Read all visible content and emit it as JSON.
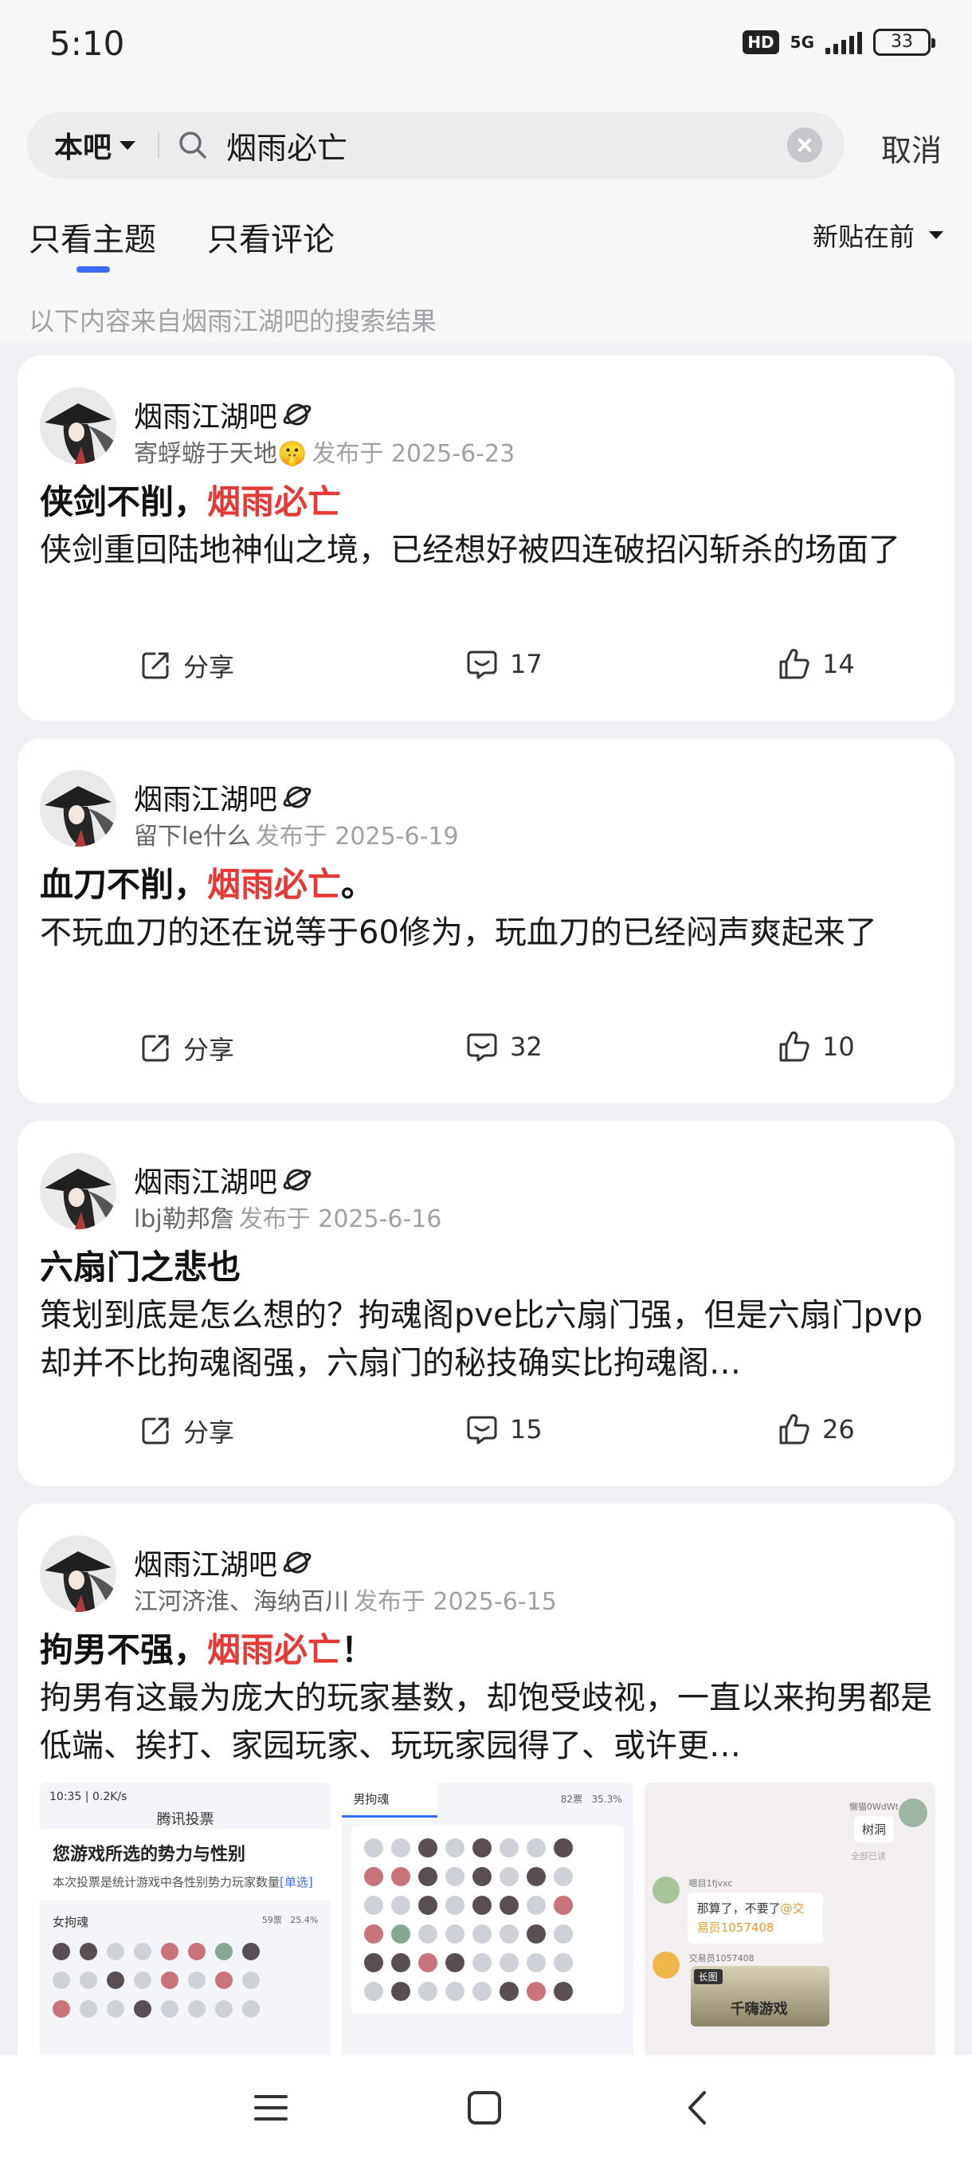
{
  "status_bar": {
    "time": "5:10",
    "hd": "HD",
    "network": "5G",
    "battery": "33"
  },
  "search": {
    "scope": "本吧",
    "query": "烟雨必亡",
    "cancel_label": "取消"
  },
  "tabs": [
    {
      "label": "只看主题",
      "active": true
    },
    {
      "label": "只看评论",
      "active": false
    }
  ],
  "sort": {
    "label": "新贴在前"
  },
  "source_note": "以下内容来自烟雨江湖吧的搜索结果",
  "posts": [
    {
      "forum": "烟雨江湖吧",
      "author": "寄蜉蝣于天地🤫",
      "date": "发布于 2025-6-23",
      "title_pre": "侠剑不削，",
      "title_hl": "烟雨必亡",
      "title_post": "",
      "body": "侠剑重回陆地神仙之境，已经想好被四连破招闪斩杀的场面了",
      "share_label": "分享",
      "comments": "17",
      "likes": "14"
    },
    {
      "forum": "烟雨江湖吧",
      "author": "留下le什么",
      "date": "发布于 2025-6-19",
      "title_pre": "血刀不削，",
      "title_hl": "烟雨必亡",
      "title_post": "。",
      "body": "不玩血刀的还在说等于60修为，玩血刀的已经闷声爽起来了",
      "share_label": "分享",
      "comments": "32",
      "likes": "10"
    },
    {
      "forum": "烟雨江湖吧",
      "author": "lbj勒邦詹",
      "date": "发布于 2025-6-16",
      "title_pre": "六扇门之悲也",
      "title_hl": "",
      "title_post": "",
      "body": "策划到底是怎么想的？拘魂阁pve比六扇门强，但是六扇门pvp却并不比拘魂阁强，六扇门的秘技确实比拘魂阁…",
      "share_label": "分享",
      "comments": "15",
      "likes": "26"
    },
    {
      "forum": "烟雨江湖吧",
      "author": "江河济淮、海纳百川",
      "date": "发布于 2025-6-15",
      "title_pre": "拘男不强，",
      "title_hl": "烟雨必亡",
      "title_post": "！",
      "body": "拘男有这最为庞大的玩家基数，却饱受歧视，一直以来拘男都是低端、挨打、家园玩家、玩玩家园得了、或许更…"
    }
  ],
  "thumbnails": {
    "first": {
      "status": "10:35 | 0.2K/s",
      "app_title": "腾讯投票",
      "heading": "您游戏所选的势力与性别",
      "desc": "本次投票是统计游戏中各性别势力玩家数量",
      "desc_tag": "[单选]",
      "section": "女拘魂",
      "count": "59票",
      "percent": "25.4%"
    },
    "second": {
      "section": "男拘魂",
      "count": "82票",
      "percent": "35.3%"
    },
    "third": {
      "chat_name": "懒猫0WdWt",
      "reply": "树洞",
      "note": "全部已读",
      "sender": "嗯目1fjvxc",
      "msg_pre": "那算了，不要了",
      "msg_mention": "@交易员1057408",
      "sender2": "交易员1057408",
      "card_tag": "长图",
      "card_title": "千嗨游戏"
    }
  }
}
